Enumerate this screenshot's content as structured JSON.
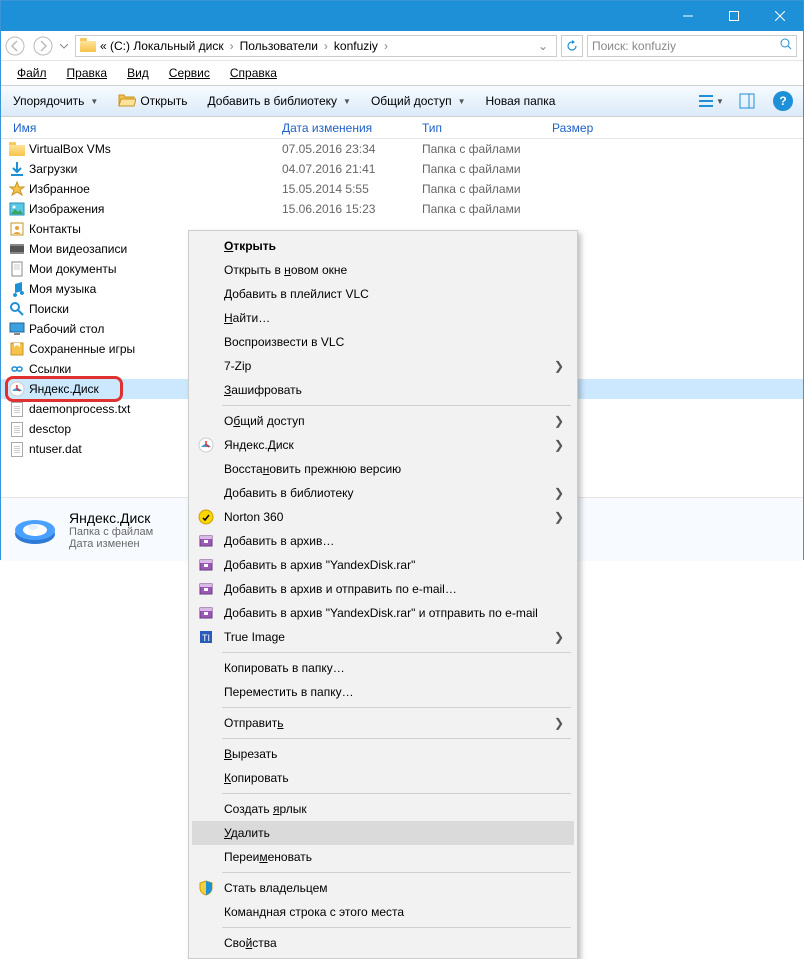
{
  "breadcrumbs": {
    "prefix": "« (C:) Локальный диск",
    "parts": [
      "Пользователи",
      "konfuziy"
    ]
  },
  "search": {
    "placeholder": "Поиск: konfuziy"
  },
  "menubar": [
    "Файл",
    "Правка",
    "Вид",
    "Сервис",
    "Справка"
  ],
  "toolbar": {
    "organize": "Упорядочить",
    "open": "Открыть",
    "add_lib": "Добавить в библиотеку",
    "share": "Общий доступ",
    "new_folder": "Новая папка"
  },
  "columns": {
    "name": "Имя",
    "date": "Дата изменения",
    "type": "Тип",
    "size": "Размер"
  },
  "files": [
    {
      "icon": "folder",
      "name": "VirtualBox VMs",
      "date": "07.05.2016 23:34",
      "type": "Папка с файлами"
    },
    {
      "icon": "dl",
      "name": "Загрузки",
      "date": "04.07.2016 21:41",
      "type": "Папка с файлами"
    },
    {
      "icon": "star",
      "name": "Избранное",
      "date": "15.05.2014 5:55",
      "type": "Папка с файлами"
    },
    {
      "icon": "pic",
      "name": "Изображения",
      "date": "15.06.2016 15:23",
      "type": "Папка с файлами"
    },
    {
      "icon": "contacts",
      "name": "Контакты",
      "date": "",
      "type": ""
    },
    {
      "icon": "video",
      "name": "Мои видеозаписи",
      "date": "",
      "type": ""
    },
    {
      "icon": "docs",
      "name": "Мои документы",
      "date": "",
      "type": ""
    },
    {
      "icon": "music",
      "name": "Моя музыка",
      "date": "",
      "type": ""
    },
    {
      "icon": "search",
      "name": "Поиски",
      "date": "",
      "type": ""
    },
    {
      "icon": "desktop",
      "name": "Рабочий стол",
      "date": "",
      "type": ""
    },
    {
      "icon": "saved",
      "name": "Сохраненные игры",
      "date": "",
      "type": ""
    },
    {
      "icon": "links",
      "name": "Ссылки",
      "date": "",
      "type": ""
    },
    {
      "icon": "ydisk",
      "name": "Яндекс.Диск",
      "date": "",
      "type": "",
      "selected": true
    },
    {
      "icon": "file",
      "name": "daemonprocess.txt",
      "date": "",
      "type": ""
    },
    {
      "icon": "file",
      "name": "desctop",
      "date": "",
      "type": ""
    },
    {
      "icon": "file",
      "name": "ntuser.dat",
      "date": "",
      "type": ""
    }
  ],
  "details": {
    "title": "Яндекс.Диск",
    "sub1": "Папка с файлам",
    "sub2": "Дата изменен"
  },
  "ctx": [
    {
      "t": "item",
      "html": "<span class='und-o'>О</span>ткрыть",
      "bold": true
    },
    {
      "t": "item",
      "html": "Открыть в <span class='und-o'>н</span>овом окне"
    },
    {
      "t": "item",
      "html": "Добавить в плейлист VLC"
    },
    {
      "t": "item",
      "html": "<span class='und-o'>Н</span>айти…"
    },
    {
      "t": "item",
      "html": "Воспроизвести в VLC"
    },
    {
      "t": "item",
      "html": "7-Zip",
      "sub": true
    },
    {
      "t": "item",
      "html": "<span class='und-o'>З</span>ашифровать"
    },
    {
      "t": "sep"
    },
    {
      "t": "item",
      "html": "О<span class='und-o'>б</span>щий доступ",
      "sub": true
    },
    {
      "t": "item",
      "html": "Яндекс.Диск",
      "sub": true,
      "icon": "ydisk"
    },
    {
      "t": "item",
      "html": "Восста<span class='und-o'>н</span>овить прежнюю версию"
    },
    {
      "t": "item",
      "html": "<span class='und-o'>Д</span>обавить в библиотеку",
      "sub": true
    },
    {
      "t": "item",
      "html": "Norton 360",
      "sub": true,
      "icon": "norton"
    },
    {
      "t": "item",
      "html": "Добавить в архив…",
      "icon": "rar"
    },
    {
      "t": "item",
      "html": "Добавить в архив \"YandexDisk.rar\"",
      "icon": "rar"
    },
    {
      "t": "item",
      "html": "Добавить в архив и отправить по e-mail…",
      "icon": "rar"
    },
    {
      "t": "item",
      "html": "Добавить в архив \"YandexDisk.rar\" и отправить по e-mail",
      "icon": "rar"
    },
    {
      "t": "item",
      "html": "True Image",
      "sub": true,
      "icon": "ti"
    },
    {
      "t": "sep"
    },
    {
      "t": "item",
      "html": "Копировать в папку…"
    },
    {
      "t": "item",
      "html": "Переместить в папку…"
    },
    {
      "t": "sep"
    },
    {
      "t": "item",
      "html": "Отправит<span class='und-o'>ь</span>",
      "sub": true
    },
    {
      "t": "sep"
    },
    {
      "t": "item",
      "html": "<span class='und-o'>В</span>ырезать"
    },
    {
      "t": "item",
      "html": "<span class='und-o'>К</span>опировать"
    },
    {
      "t": "sep"
    },
    {
      "t": "item",
      "html": "Создать <span class='und-o'>я</span>рлык"
    },
    {
      "t": "item",
      "html": "<span class='und-o'>У</span>далить",
      "hover": true,
      "hl": true
    },
    {
      "t": "item",
      "html": "Переи<span class='und-o'>м</span>еновать"
    },
    {
      "t": "sep"
    },
    {
      "t": "item",
      "html": "Стать владельцем",
      "icon": "shield"
    },
    {
      "t": "item",
      "html": "Командная строка с этого места"
    },
    {
      "t": "sep"
    },
    {
      "t": "item",
      "html": "Сво<span class='und-o'>й</span>ства"
    }
  ]
}
